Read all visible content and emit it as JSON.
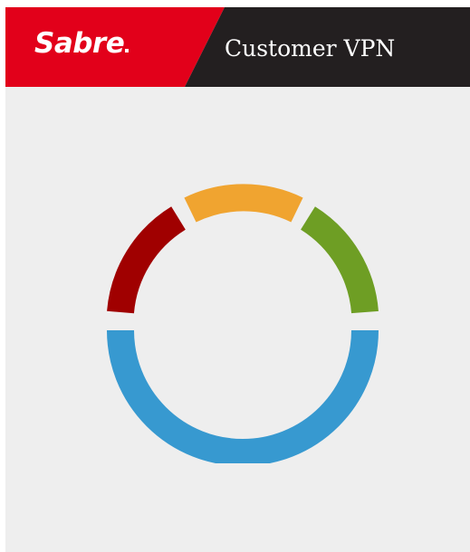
{
  "header": {
    "logo_text": "Sabre",
    "title": "Customer VPN",
    "colors": {
      "brand_red": "#e2001a",
      "dark_panel": "#231f20",
      "text": "#ffffff"
    }
  },
  "main": {
    "background": "#eeeeee",
    "loader": {
      "icon": "loading-spinner-icon",
      "segments": [
        {
          "name": "red",
          "color": "#a00000"
        },
        {
          "name": "orange",
          "color": "#f0a430"
        },
        {
          "name": "green",
          "color": "#6e9e24"
        },
        {
          "name": "blue",
          "color": "#3799d0"
        }
      ]
    }
  }
}
